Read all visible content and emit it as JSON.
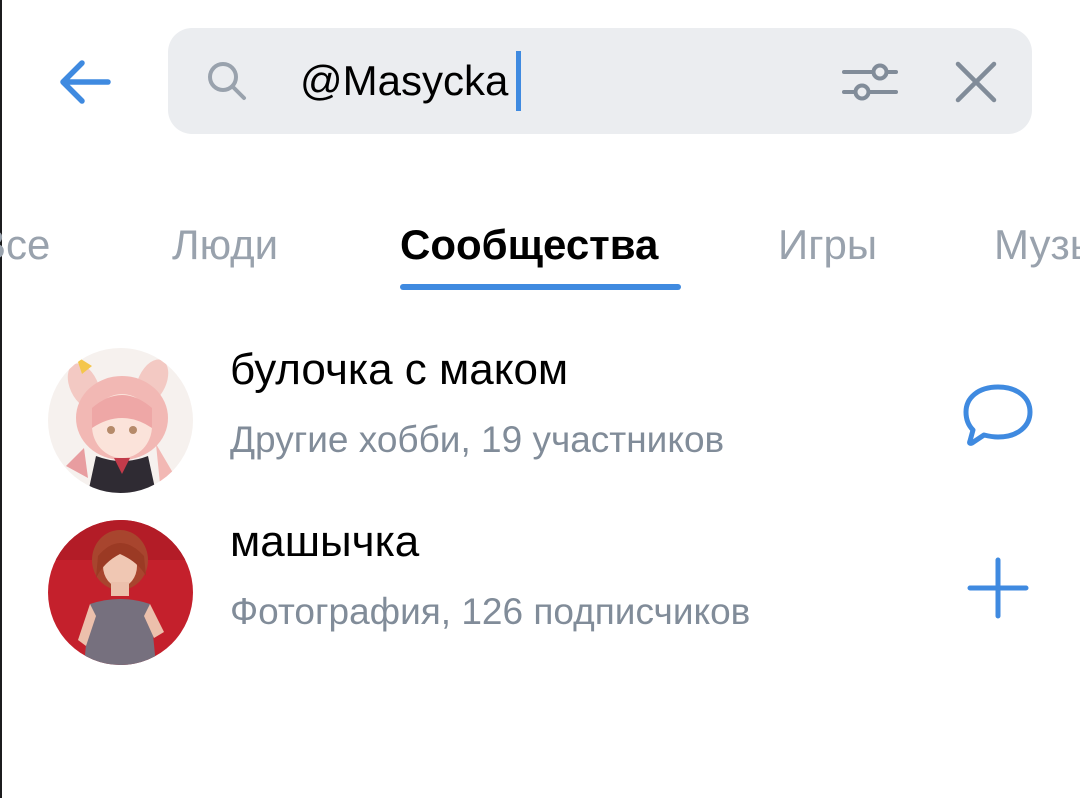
{
  "colors": {
    "accent": "#3f8ae0",
    "search_bg": "#ebedf0",
    "tab_inactive": "#99a2ad",
    "subtitle": "#818c99"
  },
  "header": {
    "back_icon": "arrow-left-icon",
    "search": {
      "icon": "search-icon",
      "value": "@Masycka",
      "filter_icon": "sliders-icon",
      "clear_icon": "close-icon"
    }
  },
  "tabs": [
    {
      "label": "Все"
    },
    {
      "label": "Люди"
    },
    {
      "label": "Сообщества",
      "active": true
    },
    {
      "label": "Игры"
    },
    {
      "label": "Музыка"
    }
  ],
  "results": [
    {
      "title": "булочка с маком",
      "subtitle": "Другие хобби, 19 участников",
      "action_icon": "message-bubble-icon"
    },
    {
      "title": "машычка",
      "subtitle": "Фотография, 126 подписчиков",
      "action_icon": "plus-icon"
    }
  ]
}
